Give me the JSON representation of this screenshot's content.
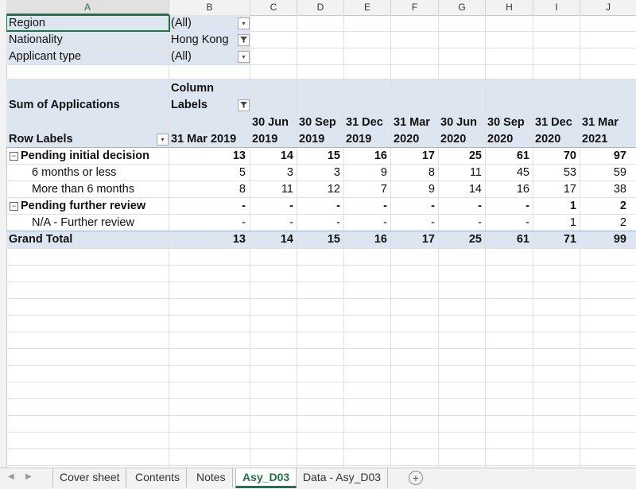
{
  "columns": [
    "A",
    "B",
    "C",
    "D",
    "E",
    "F",
    "G",
    "H",
    "I",
    "J"
  ],
  "filters": [
    {
      "label": "Region",
      "value": "(All)",
      "icon": "dropdown-icon"
    },
    {
      "label": "Nationality",
      "value": "Hong Kong",
      "icon": "filter-icon"
    },
    {
      "label": "Applicant type",
      "value": "(All)",
      "icon": "dropdown-icon"
    }
  ],
  "pivot": {
    "values_label": "Sum of Applications",
    "column_labels_line1": "Column",
    "column_labels_line2": "Labels",
    "row_labels": "Row Labels",
    "periods": [
      {
        "top": "",
        "bottom": "31 Mar 2019"
      },
      {
        "top": "30 Jun",
        "bottom": "2019"
      },
      {
        "top": "30 Sep",
        "bottom": "2019"
      },
      {
        "top": "31 Dec",
        "bottom": "2019"
      },
      {
        "top": "31 Mar",
        "bottom": "2020"
      },
      {
        "top": "30 Jun",
        "bottom": "2020"
      },
      {
        "top": "30 Sep",
        "bottom": "2020"
      },
      {
        "top": "31 Dec",
        "bottom": "2020"
      },
      {
        "top": "31 Mar",
        "bottom": "2021"
      }
    ],
    "rows": [
      {
        "label": "Pending initial decision",
        "type": "group",
        "values": [
          "13",
          "14",
          "15",
          "16",
          "17",
          "25",
          "61",
          "70",
          "97"
        ]
      },
      {
        "label": "6 months or less",
        "type": "item",
        "values": [
          "5",
          "3",
          "3",
          "9",
          "8",
          "11",
          "45",
          "53",
          "59"
        ]
      },
      {
        "label": "More than 6 months",
        "type": "item",
        "values": [
          "8",
          "11",
          "12",
          "7",
          "9",
          "14",
          "16",
          "17",
          "38"
        ]
      },
      {
        "label": "Pending further review",
        "type": "group",
        "values": [
          "-",
          "-",
          "-",
          "-",
          "-",
          "-",
          "-",
          "1",
          "2"
        ]
      },
      {
        "label": "N/A - Further review",
        "type": "item",
        "values": [
          "-",
          "-",
          "-",
          "-",
          "-",
          "-",
          "-",
          "1",
          "2"
        ]
      },
      {
        "label": "Grand Total",
        "type": "total",
        "values": [
          "13",
          "14",
          "15",
          "16",
          "17",
          "25",
          "61",
          "71",
          "99"
        ]
      }
    ]
  },
  "tabs": [
    {
      "label": "Cover sheet",
      "active": false
    },
    {
      "label": "Contents",
      "active": false
    },
    {
      "label": "Notes",
      "active": false
    },
    {
      "label": "Asy_D03",
      "active": true
    },
    {
      "label": "Data - Asy_D03",
      "active": false
    }
  ],
  "accent": "#217346",
  "band_color": "#dde6f0"
}
